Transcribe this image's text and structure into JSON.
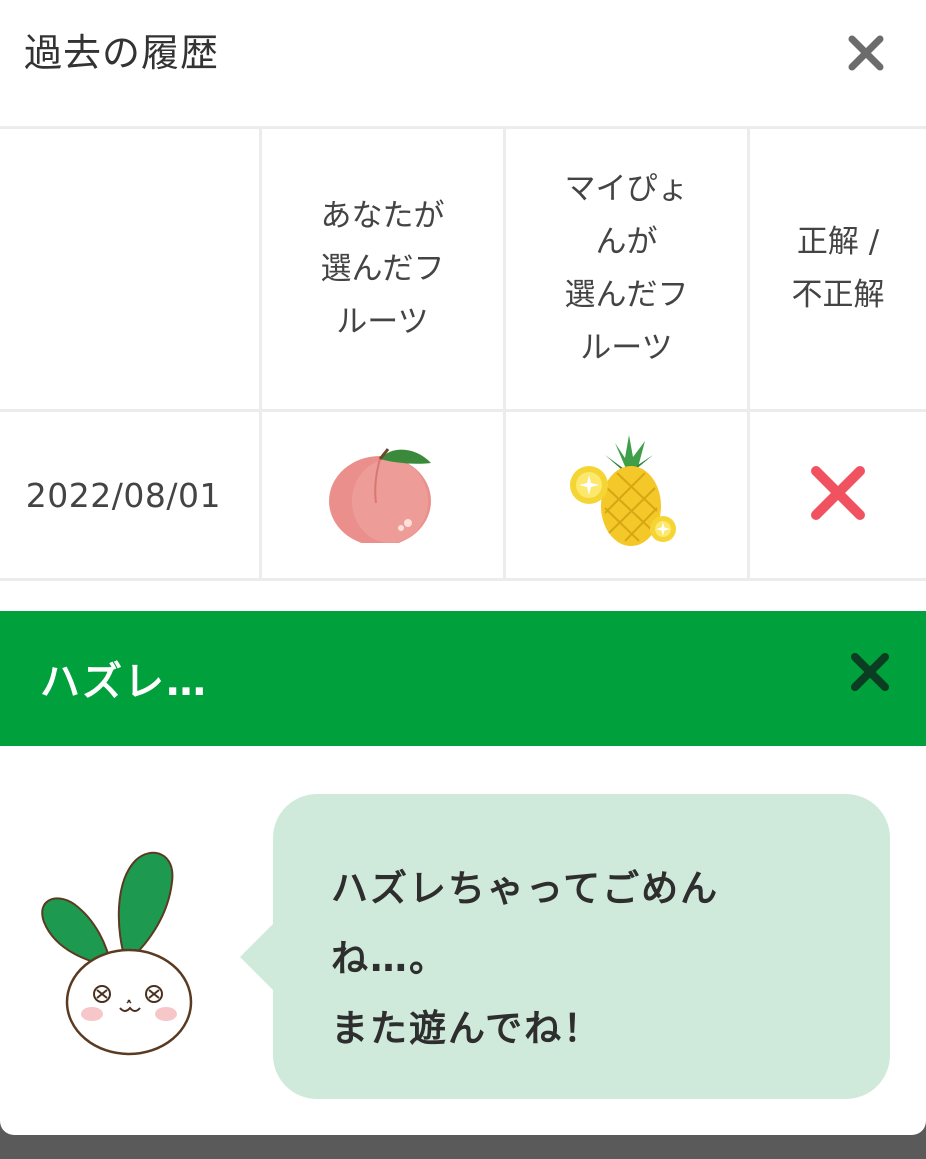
{
  "history": {
    "title": "過去の履歴",
    "columns": [
      "",
      "あなたが\n選んだフ\nルーツ",
      "マイぴょ\nんが\n選んだフ\nルーツ",
      "正解 /\n不正解"
    ],
    "rows": [
      {
        "date": "2022/08/01",
        "your_fruit_icon": "peach-icon",
        "mypyon_fruit_icon": "pineapple-icon",
        "result_icon": "incorrect-x-icon"
      }
    ]
  },
  "result": {
    "title": "ハズレ…",
    "message": "ハズレちゃってごめん\nね…。\nまた遊んでね！",
    "mascot_icon": "rabbit-mascot-icon"
  },
  "colors": {
    "banner_green": "#00a03c",
    "bubble_green": "#cfeadb",
    "incorrect_red": "#f0535f"
  }
}
